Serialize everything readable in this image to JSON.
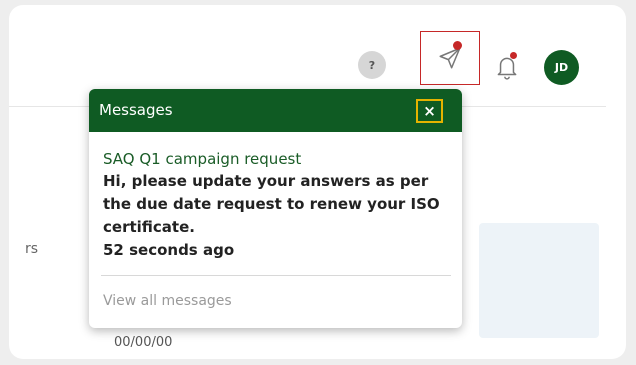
{
  "header": {
    "help_label": "?",
    "avatar_initials": "JD"
  },
  "background": {
    "partial_text": "rs",
    "partial_date": "00/00/00"
  },
  "messages_popup": {
    "title": "Messages",
    "close_label": "×",
    "message": {
      "title": "SAQ Q1 campaign request",
      "body": "Hi, please update your answers as per the due date request to renew your ISO certificate.",
      "time": "52 seconds ago"
    },
    "view_all_label": "View all messages"
  },
  "colors": {
    "brand_green": "#0f5b23",
    "alert_red": "#c62828",
    "focus_yellow": "#e5b300"
  },
  "icons": [
    "help-icon",
    "send-icon",
    "bell-icon",
    "close-icon"
  ]
}
